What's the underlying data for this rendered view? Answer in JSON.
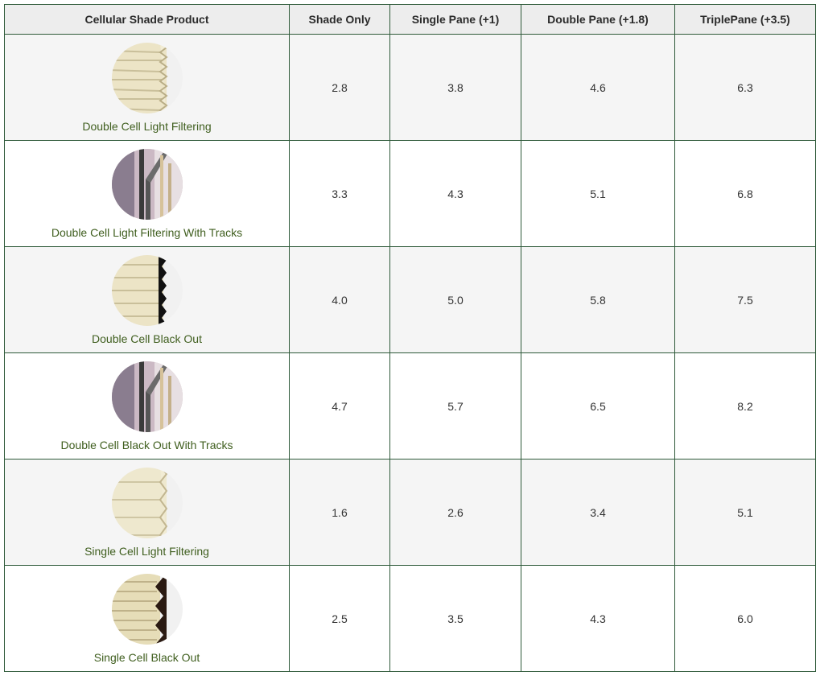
{
  "table": {
    "headers": [
      "Cellular Shade Product",
      "Shade Only",
      "Single Pane (+1)",
      "Double Pane (+1.8)",
      "TriplePane (+3.5)"
    ],
    "rows": [
      {
        "product": "Double Cell Light Filtering",
        "icon": "double-cell-light-filtering-icon",
        "values": [
          "2.8",
          "3.8",
          "4.6",
          "6.3"
        ]
      },
      {
        "product": "Double Cell Light Filtering With Tracks",
        "icon": "double-cell-tracks-icon",
        "values": [
          "3.3",
          "4.3",
          "5.1",
          "6.8"
        ]
      },
      {
        "product": "Double Cell Black Out",
        "icon": "double-cell-blackout-icon",
        "values": [
          "4.0",
          "5.0",
          "5.8",
          "7.5"
        ]
      },
      {
        "product": "Double Cell Black Out With Tracks",
        "icon": "double-cell-blackout-tracks-icon",
        "values": [
          "4.7",
          "5.7",
          "6.5",
          "8.2"
        ]
      },
      {
        "product": "Single Cell Light Filtering",
        "icon": "single-cell-light-filtering-icon",
        "values": [
          "1.6",
          "2.6",
          "3.4",
          "5.1"
        ]
      },
      {
        "product": "Single Cell Black Out",
        "icon": "single-cell-blackout-icon",
        "values": [
          "2.5",
          "3.5",
          "4.3",
          "6.0"
        ]
      }
    ]
  },
  "colors": {
    "border": "#2f5a3a",
    "header_bg": "#ededed",
    "alt_row_bg": "#f5f5f5",
    "product_text": "#3f5e1e",
    "shade_cream": "#eee6c8"
  }
}
